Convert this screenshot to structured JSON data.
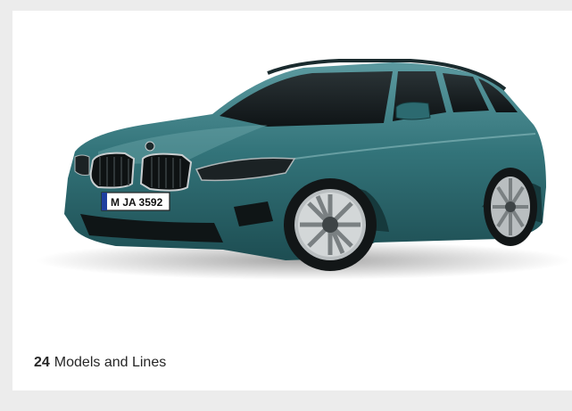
{
  "product": {
    "image_label": "BMW 3 Series Touring, teal",
    "plate_text": "M JA 3592",
    "model_count": "24",
    "models_label": "Models and Lines"
  },
  "colors": {
    "page_background": "#ececec",
    "card_background": "#ffffff",
    "car_paint": "#2f6f74",
    "text": "#262626"
  }
}
